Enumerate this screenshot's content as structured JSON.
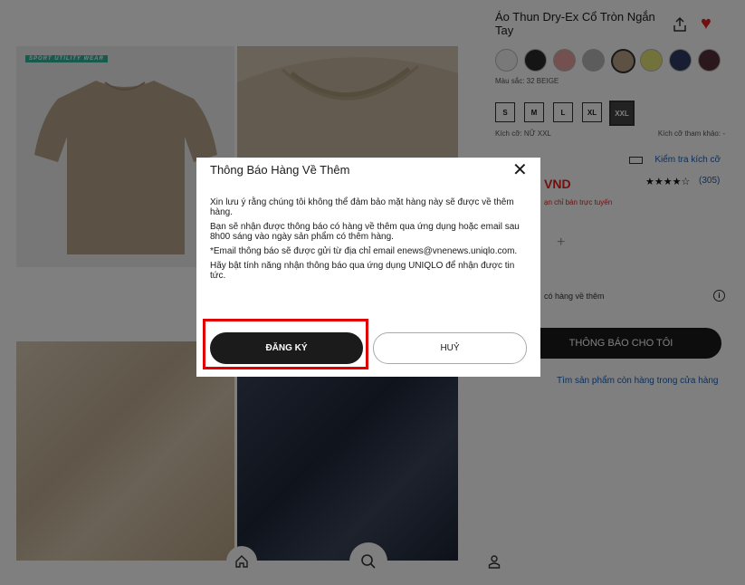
{
  "gallery": {
    "badge": "SPORT UTILITY WEAR"
  },
  "product": {
    "title": "Áo Thun Dry-Ex Cổ Tròn Ngắn Tay",
    "color_label": "Màu sắc: 32 BEIGE",
    "swatches": [
      "#f2f2f2",
      "#2b2b2b",
      "#e7a3a0",
      "#b9b9b9",
      "#b8a286",
      "#e6e576",
      "#2f3c66",
      "#57303a"
    ],
    "sizes": [
      "S",
      "M",
      "L",
      "XL",
      "XXL"
    ],
    "selected_size": "XXL",
    "size_label": "Kích cỡ: NỮ XXL",
    "size_ref": "Kích cỡ tham khảo: -",
    "check_size": "Kiểm tra kích cỡ",
    "price": "VND",
    "stars": "★★★★☆",
    "reviews": "(305)",
    "online_note": "ạn chỉ bán trực tuyến",
    "plus": "+",
    "notify_text": "có hàng về thêm",
    "info_icon": "i",
    "notify_button": "THÔNG BÁO CHO TÔI",
    "store_link": "Tìm sản phẩm còn hàng trong cửa hàng"
  },
  "modal": {
    "title": "Thông Báo Hàng Về Thêm",
    "messages": [
      "Xin lưu ý rằng chúng tôi không thể đảm bảo mặt hàng này sẽ được về thêm hàng.",
      "Bạn sẽ nhận được thông báo có hàng về thêm qua ứng dụng hoặc email sau 8h00 sáng vào ngày sản phẩm có thêm hàng.",
      "*Email thông báo sẽ được gửi từ địa chỉ email enews@vnenews.uniqlo.com.",
      "Hãy bật tính năng nhận thông báo qua ứng dụng UNIQLO để nhận được tin tức."
    ],
    "register": "ĐĂNG KÝ",
    "cancel": "HUỶ"
  },
  "icons": {
    "share": "share-icon",
    "heart": "heart-icon",
    "close": "close-icon",
    "home": "home-icon",
    "search": "search-icon",
    "user": "user-icon"
  },
  "colors": {
    "accent_red": "#e02020",
    "link_blue": "#1a5fb4",
    "dark": "#1b1b1b",
    "highlight": "#e00000"
  }
}
